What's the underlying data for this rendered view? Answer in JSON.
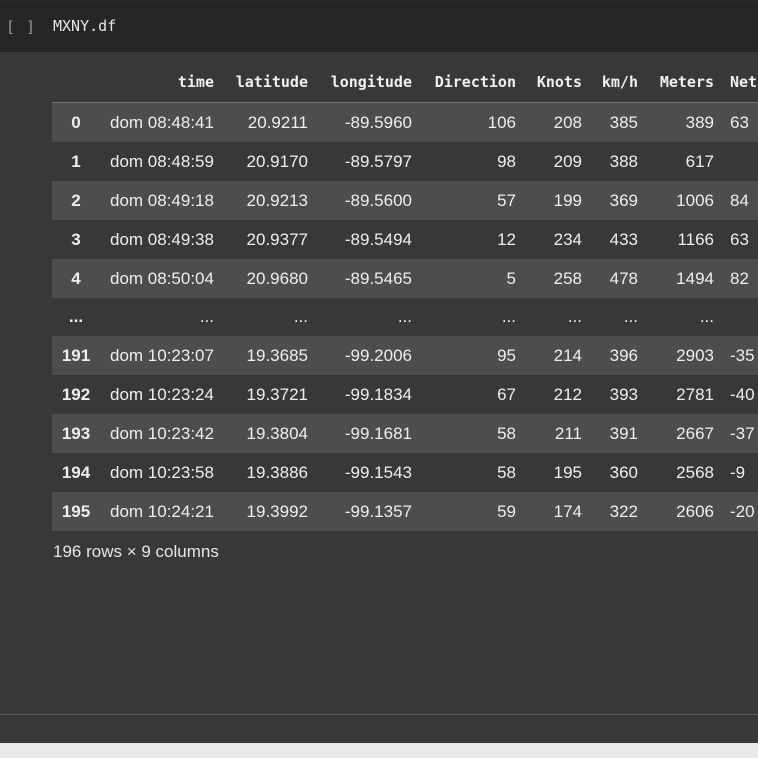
{
  "cell": {
    "run_indicator": "[ ]",
    "code": "MXNY.df"
  },
  "dataframe": {
    "columns": [
      "",
      "time",
      "latitude",
      "longitude",
      "Direction",
      "Knots",
      "km/h",
      "Meters",
      "Net"
    ],
    "rows": [
      {
        "index": "0",
        "time": "dom 08:48:41",
        "latitude": "20.9211",
        "longitude": "-89.5960",
        "direction": "106",
        "knots": "208",
        "kmh": "385",
        "meters": "389",
        "net": "63"
      },
      {
        "index": "1",
        "time": "dom 08:48:59",
        "latitude": "20.9170",
        "longitude": "-89.5797",
        "direction": "98",
        "knots": "209",
        "kmh": "388",
        "meters": "617",
        "net": ""
      },
      {
        "index": "2",
        "time": "dom 08:49:18",
        "latitude": "20.9213",
        "longitude": "-89.5600",
        "direction": "57",
        "knots": "199",
        "kmh": "369",
        "meters": "1006",
        "net": "84"
      },
      {
        "index": "3",
        "time": "dom 08:49:38",
        "latitude": "20.9377",
        "longitude": "-89.5494",
        "direction": "12",
        "knots": "234",
        "kmh": "433",
        "meters": "1166",
        "net": "63"
      },
      {
        "index": "4",
        "time": "dom 08:50:04",
        "latitude": "20.9680",
        "longitude": "-89.5465",
        "direction": "5",
        "knots": "258",
        "kmh": "478",
        "meters": "1494",
        "net": "82"
      },
      {
        "index": "...",
        "time": "...",
        "latitude": "...",
        "longitude": "...",
        "direction": "...",
        "knots": "...",
        "kmh": "...",
        "meters": "...",
        "net": ""
      },
      {
        "index": "191",
        "time": "dom 10:23:07",
        "latitude": "19.3685",
        "longitude": "-99.2006",
        "direction": "95",
        "knots": "214",
        "kmh": "396",
        "meters": "2903",
        "net": "-35"
      },
      {
        "index": "192",
        "time": "dom 10:23:24",
        "latitude": "19.3721",
        "longitude": "-99.1834",
        "direction": "67",
        "knots": "212",
        "kmh": "393",
        "meters": "2781",
        "net": "-40"
      },
      {
        "index": "193",
        "time": "dom 10:23:42",
        "latitude": "19.3804",
        "longitude": "-99.1681",
        "direction": "58",
        "knots": "211",
        "kmh": "391",
        "meters": "2667",
        "net": "-37"
      },
      {
        "index": "194",
        "time": "dom 10:23:58",
        "latitude": "19.3886",
        "longitude": "-99.1543",
        "direction": "58",
        "knots": "195",
        "kmh": "360",
        "meters": "2568",
        "net": "-9"
      },
      {
        "index": "195",
        "time": "dom 10:24:21",
        "latitude": "19.3992",
        "longitude": "-99.1357",
        "direction": "59",
        "knots": "174",
        "kmh": "322",
        "meters": "2606",
        "net": "-20"
      }
    ],
    "footer": "196 rows × 9 columns"
  },
  "colors": {
    "cell_header_bg": "#262626",
    "output_bg": "#383838",
    "stripe_bg": "#4d4d4d",
    "text": "#eeeeee"
  }
}
